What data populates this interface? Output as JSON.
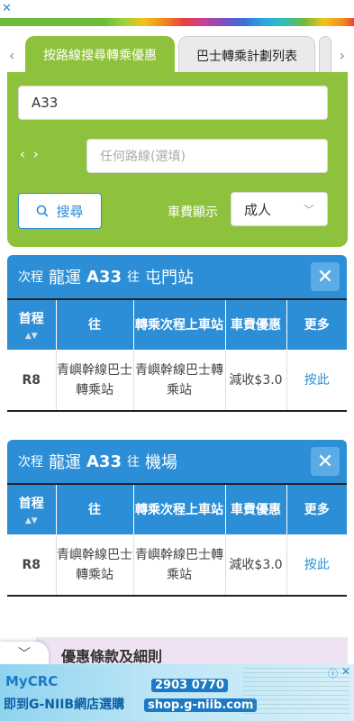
{
  "top_ad": {
    "close_icon": "✕"
  },
  "tabs": {
    "prev_icon": "‹",
    "next_icon": "›",
    "active_label": "按路線搜尋轉乘優惠",
    "inactive_label": "巴士轉乘計劃列表"
  },
  "search": {
    "route_value": "A33",
    "swap_icon": "‹ ›",
    "second_route_placeholder": "任何路線(選填)",
    "search_label": "搜尋",
    "fare_label": "車費顯示",
    "fare_value": "成人",
    "fare_chevron": "﹀"
  },
  "results": [
    {
      "prefix": "次程",
      "operator": "龍運",
      "route": "A33",
      "towards": "往",
      "destination": "屯門站",
      "close_icon": "✕",
      "headers": [
        "首程",
        "往",
        "轉乘次程上車站",
        "車費優惠",
        "更多"
      ],
      "sort_icon": "▲▼",
      "row": {
        "first_route": "R8",
        "first_towards": "青嶼幹線巴士轉乘站",
        "board_stop": "青嶼幹線巴士轉乘站",
        "discount": "減收$3.0",
        "more": "按此"
      }
    },
    {
      "prefix": "次程",
      "operator": "龍運",
      "route": "A33",
      "towards": "往",
      "destination": "機場",
      "close_icon": "✕",
      "headers": [
        "首程",
        "往",
        "轉乘次程上車站",
        "車費優惠",
        "更多"
      ],
      "sort_icon": "▲▼",
      "row": {
        "first_route": "R8",
        "first_towards": "青嶼幹線巴士轉乘站",
        "board_stop": "青嶼幹線巴士轉乘站",
        "discount": "減收$3.0",
        "more": "按此"
      }
    }
  ],
  "terms_label": "優惠條款及細則",
  "collapse_icon": "﹀",
  "bottom_ad": {
    "brand": "MyCRC",
    "slogan": "即到G-NIIB網店選購",
    "phone": "2903 0770",
    "site": "shop.g-niib.com",
    "info_icon": "ⓘ",
    "close_icon": "✕"
  }
}
